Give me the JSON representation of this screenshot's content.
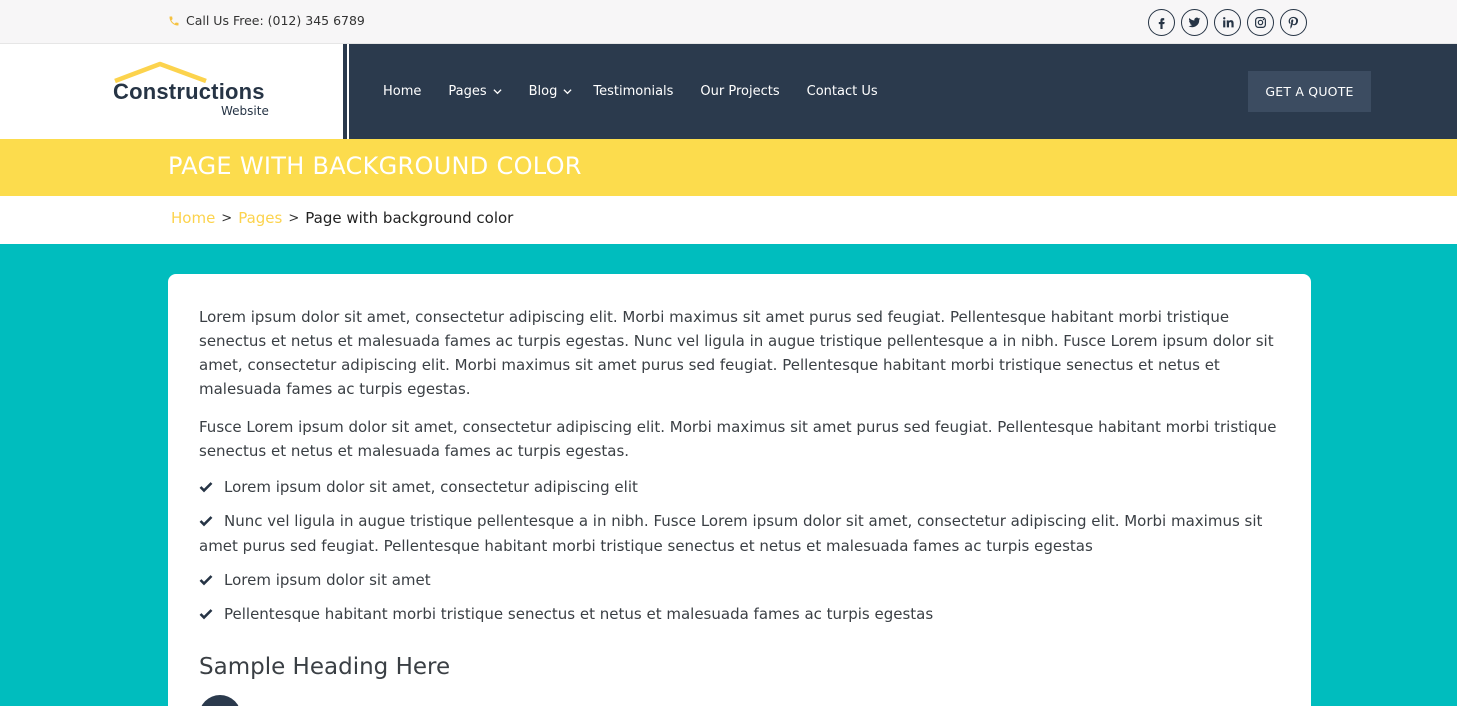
{
  "topbar": {
    "phone_text": "Call Us Free: (012) 345 6789",
    "social": [
      {
        "icon": "facebook-icon",
        "glyph": "f"
      },
      {
        "icon": "twitter-icon",
        "glyph": ""
      },
      {
        "icon": "linkedin-icon",
        "glyph": "in"
      },
      {
        "icon": "instagram-icon",
        "glyph": ""
      },
      {
        "icon": "pinterest-icon",
        "glyph": "p"
      }
    ]
  },
  "logo": {
    "title": "Constructions",
    "subtitle": "Website"
  },
  "nav": {
    "home": "Home",
    "pages": "Pages",
    "blog": "Blog",
    "testimonials": "Testimonials",
    "projects": "Our Projects",
    "contact": "Contact Us",
    "quote_button": "GET A QUOTE"
  },
  "page": {
    "title": "PAGE WITH BACKGROUND COLOR"
  },
  "breadcrumb": {
    "home": "Home",
    "pages": "Pages",
    "current": "Page with background color",
    "separator": ">"
  },
  "content": {
    "paragraph1": "Lorem ipsum dolor sit amet, consectetur adipiscing elit. Morbi maximus sit amet purus sed feugiat. Pellentesque habitant morbi tristique senectus et netus et malesuada fames ac turpis egestas. Nunc vel ligula in augue tristique pellentesque a in nibh. Fusce Lorem ipsum dolor sit amet, consectetur adipiscing elit. Morbi maximus sit amet purus sed feugiat. Pellentesque habitant morbi tristique senectus et netus et malesuada fames ac turpis egestas.",
    "paragraph2": "Fusce Lorem ipsum dolor sit amet, consectetur adipiscing elit. Morbi maximus sit amet purus sed feugiat. Pellentesque habitant morbi tristique senectus et netus et malesuada fames ac turpis egestas.",
    "list": [
      "Lorem ipsum dolor sit amet, consectetur adipiscing elit",
      "Nunc vel ligula in augue tristique pellentesque a in nibh. Fusce Lorem ipsum dolor sit amet, consectetur adipiscing elit. Morbi maximus sit amet purus sed feugiat. Pellentesque habitant morbi tristique senectus et netus et malesuada fames ac turpis egestas",
      "Lorem ipsum dolor sit amet",
      "Pellentesque habitant morbi tristique senectus et netus et malesuada fames ac turpis egestas"
    ],
    "sample_heading": "Sample Heading Here"
  },
  "colors": {
    "accent_yellow": "#fcdc4d",
    "navy": "#2b3a4d",
    "teal_background": "#00bdbe"
  }
}
